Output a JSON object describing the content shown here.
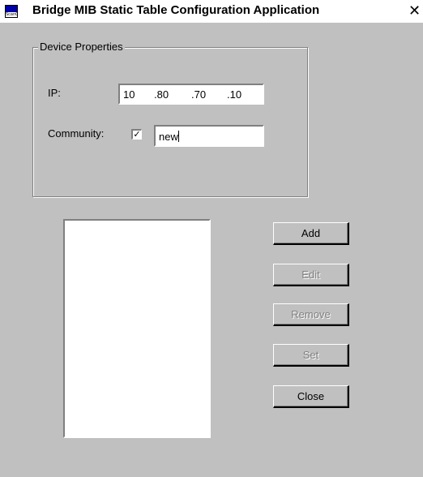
{
  "window": {
    "title": "Bridge MIB Static Table Configuration Application",
    "icon_label": "ScanC",
    "close_glyph": "✕"
  },
  "device_properties": {
    "legend": "Device Properties",
    "ip_label": "IP:",
    "ip_octets": [
      "10",
      ".80",
      ".70",
      ".10"
    ],
    "community_label": "Community:",
    "community_checked": true,
    "checkbox_glyph": "✓",
    "community_value": "new"
  },
  "buttons": {
    "add": "Add",
    "edit": "Edit",
    "remove": "Remove",
    "set": "Set",
    "close": "Close"
  },
  "button_state": {
    "add": "enabled",
    "edit": "disabled",
    "remove": "disabled",
    "set": "disabled",
    "close": "enabled"
  },
  "list": {
    "items": []
  }
}
